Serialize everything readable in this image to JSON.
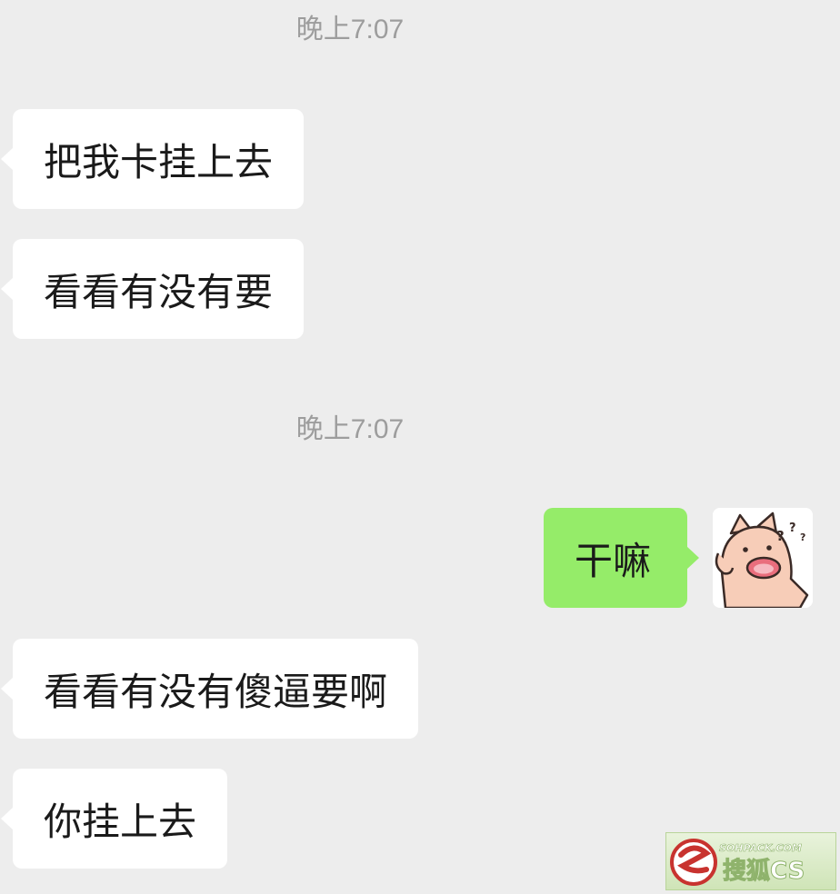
{
  "chat": {
    "timestamps": [
      "晚上7:07",
      "晚上7:07"
    ],
    "messages": [
      {
        "side": "in",
        "text": "把我卡挂上去"
      },
      {
        "side": "in",
        "text": "看看有没有要"
      },
      {
        "side": "out",
        "text": "干嘛"
      },
      {
        "side": "in",
        "text": "看看有没有傻逼要啊"
      },
      {
        "side": "in",
        "text": "你挂上去"
      }
    ],
    "self_avatar": "pig-sticker-avatar",
    "colors": {
      "background": "#ededed",
      "incoming": "#ffffff",
      "outgoing": "#95ec69",
      "timestamp": "#9d9d9d"
    }
  },
  "watermark": {
    "url_text": "SOHPACK.COM",
    "logo_text": "搜狐CS"
  }
}
